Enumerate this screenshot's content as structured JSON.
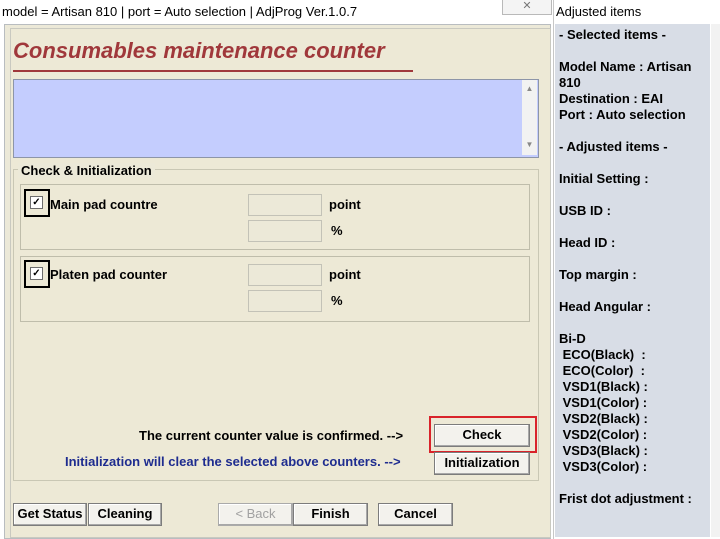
{
  "window": {
    "title": "model = Artisan 810 | port = Auto selection | AdjProg Ver.1.0.7",
    "close_glyph": "✕"
  },
  "main": {
    "heading": "Consumables maintenance counter",
    "group_label": "Check & Initialization",
    "main_pad": {
      "label": "Main pad countre",
      "checked": true,
      "unit_point": "point",
      "unit_percent": "%",
      "point_value": "",
      "percent_value": ""
    },
    "platen_pad": {
      "label": "Platen pad counter",
      "checked": true,
      "unit_point": "point",
      "unit_percent": "%",
      "point_value": "",
      "percent_value": ""
    },
    "confirm_text": "The current counter value is confirmed. -->",
    "init_text": "Initialization will clear the selected above counters. -->",
    "check_label": "Check",
    "init_label": "Initialization",
    "scroll_up": "▲",
    "scroll_down": "▼"
  },
  "footer": {
    "get_status": "Get Status",
    "cleaning": "Cleaning",
    "back": "< Back",
    "finish": "Finish",
    "cancel": "Cancel"
  },
  "side": {
    "title": "Adjusted items",
    "lines": [
      "- Selected items -",
      "Model Name : Artisan",
      "810",
      "Destination : EAI",
      "Port : Auto selection",
      "- Adjusted items -",
      "Initial Setting :",
      "USB ID :",
      "Head ID :",
      "Top margin :",
      "Head Angular :",
      "Bi-D",
      " ECO(Black)  :",
      " ECO(Color)  :",
      " VSD1(Black) :",
      " VSD1(Color) :",
      " VSD2(Black) :",
      " VSD2(Color) :",
      " VSD3(Black) :",
      " VSD3(Color) :",
      "Frist dot adjustment :"
    ]
  },
  "colors": {
    "heading": "#a0383b",
    "highlight": "#d9232a",
    "info_bg": "#c4cdfe",
    "init_text": "#1e2c8f"
  }
}
